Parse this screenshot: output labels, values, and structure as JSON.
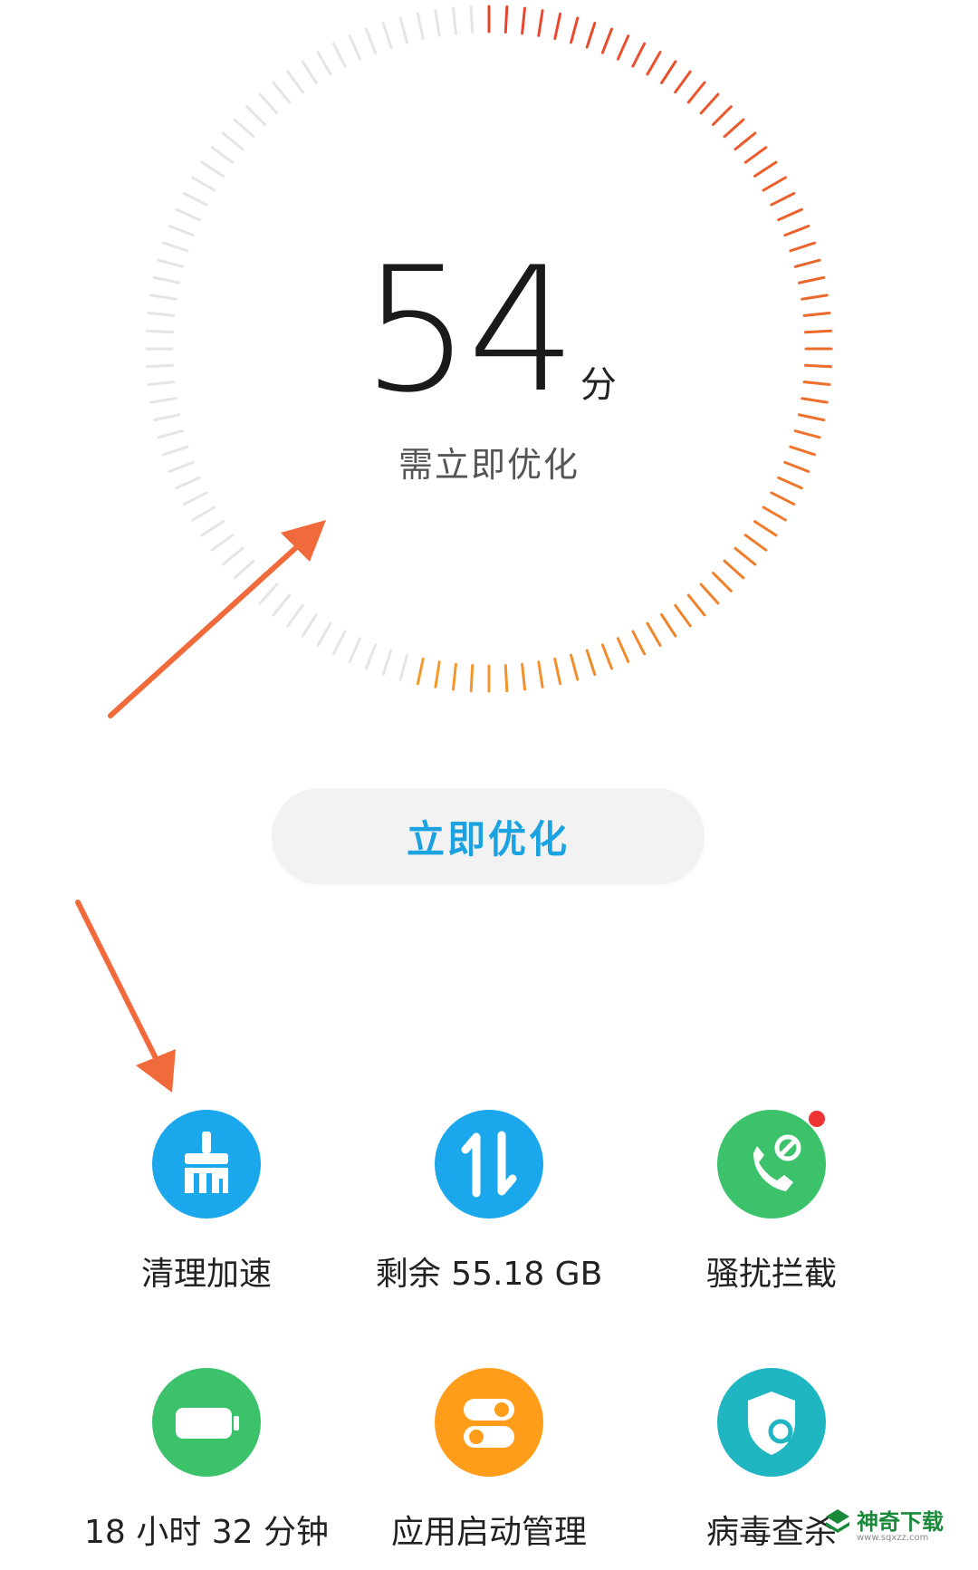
{
  "score": {
    "value": "54",
    "unit": "分",
    "status": "需立即优化",
    "level_percent": 54
  },
  "optimize_button": {
    "label": "立即优化"
  },
  "tools": [
    {
      "label": "清理加速",
      "icon": "broom-icon",
      "color": "#1aa7ec"
    },
    {
      "label": "剩余 55.18 GB",
      "icon": "transfer-arrows-icon",
      "color": "#1aa7ec"
    },
    {
      "label": "骚扰拦截",
      "icon": "phone-block-icon",
      "color": "#3cc26a",
      "badge": true
    },
    {
      "label": "18 小时 32 分钟",
      "icon": "battery-icon",
      "color": "#3cc26a"
    },
    {
      "label": "应用启动管理",
      "icon": "toggle-switches-icon",
      "color": "#ff9d1a"
    },
    {
      "label": "病毒查杀",
      "icon": "shield-search-icon",
      "color": "#1fb5c1"
    }
  ],
  "colors": {
    "gauge_hot": "#e8432d",
    "gauge_warm": "#f39a2b",
    "gauge_inactive": "#e5e5e5",
    "accent": "#1aa3e0",
    "annotation_arrow": "#f06a3c",
    "badge": "#ee3333"
  },
  "watermark": {
    "text": "神奇下载",
    "url": "www.sqxzz.com"
  }
}
